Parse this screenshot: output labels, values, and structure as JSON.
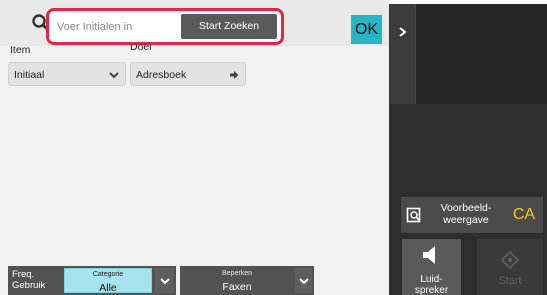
{
  "search": {
    "placeholder": "Voer Initialen in",
    "start_label": "Start Zoeken",
    "ok_label": "OK"
  },
  "columns": {
    "item_label": "Item",
    "doel_label": "Doel"
  },
  "dropdowns": {
    "item_value": "Initiaal",
    "doel_value": "Adresboek"
  },
  "bottom": {
    "freq_label_line1": "Freq.",
    "freq_label_line2": "Gebruik",
    "category_caption": "Categorie",
    "category_value": "Alle",
    "limit_caption": "Beperken",
    "limit_value": "Faxen"
  },
  "right_panel": {
    "preview_line1": "Voorbeeld-",
    "preview_line2": "weergave",
    "ca_label": "CA",
    "speaker_line1": "Luid-",
    "speaker_line2": "spreker",
    "start_label": "Start"
  },
  "colors": {
    "highlight": "#e0284a",
    "ok_button": "#25b6c6",
    "category_selected": "#a6e3ec",
    "ca_text": "#f5c518"
  },
  "icons": [
    "search-icon",
    "chevron-down-icon",
    "arrow-right-icon",
    "chevron-right-icon",
    "preview-icon",
    "speaker-icon",
    "start-diamond-icon"
  ]
}
